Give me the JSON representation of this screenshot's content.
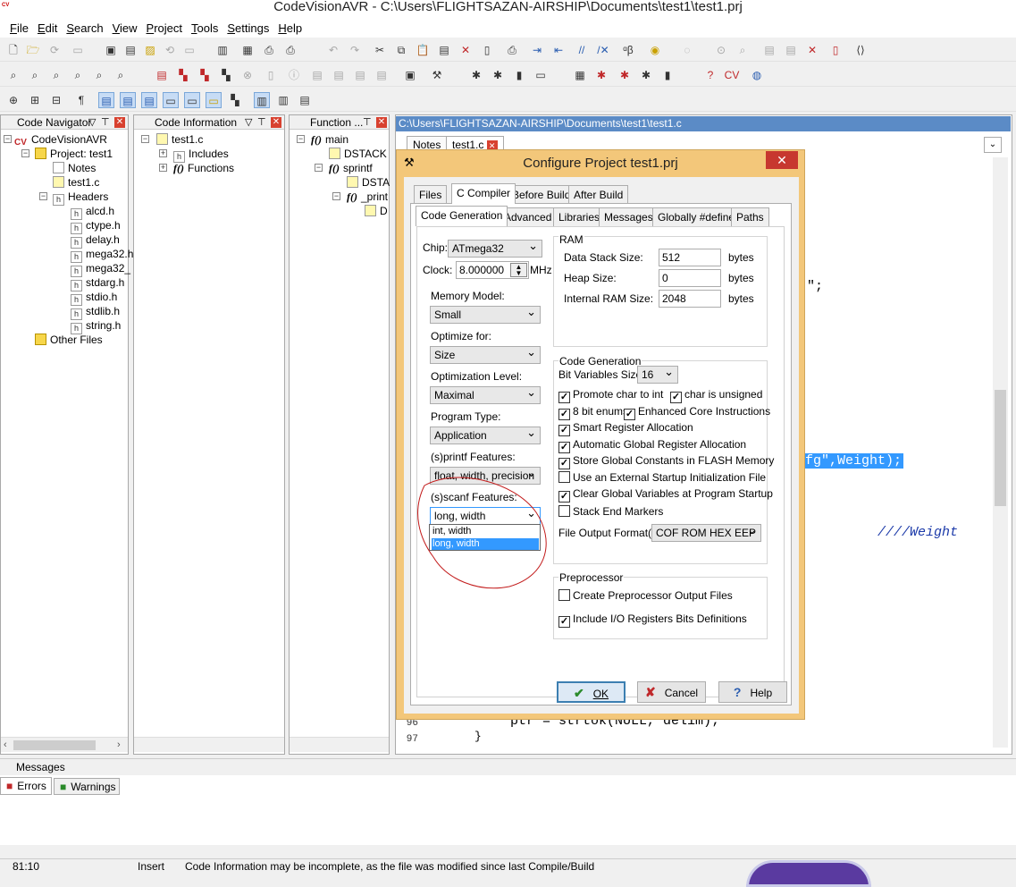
{
  "window": {
    "title": "CodeVisionAVR - C:\\Users\\FLIGHTSAZAN-AIRSHIP\\Documents\\test1\\test1.prj",
    "app_logo": "CV AVR"
  },
  "menu": [
    "File",
    "Edit",
    "Search",
    "View",
    "Project",
    "Tools",
    "Settings",
    "Help"
  ],
  "code_navigator": {
    "header": "Code Navigator",
    "root": "CodeVisionAVR",
    "project": "Project: test1",
    "notes": "Notes",
    "file": "test1.c",
    "headers_label": "Headers",
    "headers": [
      "alcd.h",
      "ctype.h",
      "delay.h",
      "mega32.h",
      "mega32_",
      "stdarg.h",
      "stdio.h",
      "stdlib.h",
      "string.h"
    ],
    "other_files": "Other Files"
  },
  "code_information": {
    "header": "Code Information",
    "file": "test1.c",
    "includes": "Includes",
    "functions": "Functions"
  },
  "function_panel": {
    "header": "Function ...",
    "items": [
      "main",
      "DSTACK",
      "sprintf",
      "DSTA",
      "_print",
      "D"
    ]
  },
  "editor": {
    "path": "C:\\Users\\FLIGHTSAZAN-AIRSHIP\\Documents\\test1\\test1.c",
    "tabs": [
      "Notes",
      "test1.c"
    ],
    "code_fragments": {
      "semicolon": "\";",
      "selected": "fg\",Weight);",
      "comment": "////Weight",
      "line96": "ptr = strtok(NULL, delim);",
      "line97": "}"
    },
    "line_numbers": [
      "96",
      "97"
    ]
  },
  "dialog": {
    "title": "Configure Project test1.prj",
    "tabs_top": [
      "Files",
      "C Compiler",
      "Before Build",
      "After Build"
    ],
    "tabs_sub": [
      "Code Generation",
      "Advanced",
      "Libraries",
      "Messages",
      "Globally #define",
      "Paths"
    ],
    "chip_label": "Chip:",
    "chip_value": "ATmega32",
    "clock_label": "Clock:",
    "clock_value": "8.000000",
    "clock_unit": "MHz",
    "memory_model_label": "Memory Model:",
    "memory_model_value": "Small",
    "optimize_for_label": "Optimize for:",
    "optimize_for_value": "Size",
    "opt_level_label": "Optimization Level:",
    "opt_level_value": "Maximal",
    "program_type_label": "Program Type:",
    "program_type_value": "Application",
    "printf_label": "(s)printf Features:",
    "printf_value": "float, width, precision",
    "scanf_label": "(s)scanf Features:",
    "scanf_value": "long, width",
    "scanf_options": [
      "int, width",
      "long, width"
    ],
    "ram": {
      "title": "RAM",
      "data_stack_label": "Data Stack Size:",
      "data_stack_value": "512",
      "heap_label": "Heap Size:",
      "heap_value": "0",
      "internal_ram_label": "Internal RAM Size:",
      "internal_ram_value": "2048",
      "unit": "bytes"
    },
    "codegen": {
      "title": "Code Generation",
      "bitvar_label": "Bit Variables Size:",
      "bitvar_value": "16",
      "promote": "Promote char to int",
      "char_unsigned": "char is unsigned",
      "enums8": "8 bit enums",
      "enhanced": "Enhanced Core Instructions",
      "smart_reg": "Smart Register Allocation",
      "auto_global": "Automatic Global Register Allocation",
      "store_flash": "Store Global Constants in FLASH Memory",
      "ext_startup": "Use an External Startup Initialization File",
      "clear_globals": "Clear Global Variables at Program Startup",
      "stack_end": "Stack End Markers",
      "output_format_label": "File Output Format(s):",
      "output_format_value": "COF ROM HEX EEP"
    },
    "preprocessor": {
      "title": "Preprocessor",
      "create_output": "Create Preprocessor Output Files",
      "include_io": "Include I/O Registers Bits Definitions"
    },
    "buttons": {
      "ok": "OK",
      "cancel": "Cancel",
      "help": "Help"
    }
  },
  "messages": {
    "header": "Messages",
    "tabs": [
      "Errors",
      "Warnings"
    ]
  },
  "status": {
    "position": "81:10",
    "mode": "Insert",
    "message": "Code Information may be incomplete, as the file was modified since last Compile/Build"
  },
  "colors": {
    "accent": "#3399ff",
    "dialog_frame": "#f3c77a",
    "close_red": "#c7372f",
    "editor_title": "#5b8bc6",
    "code_blue": "#1c3aa9"
  }
}
